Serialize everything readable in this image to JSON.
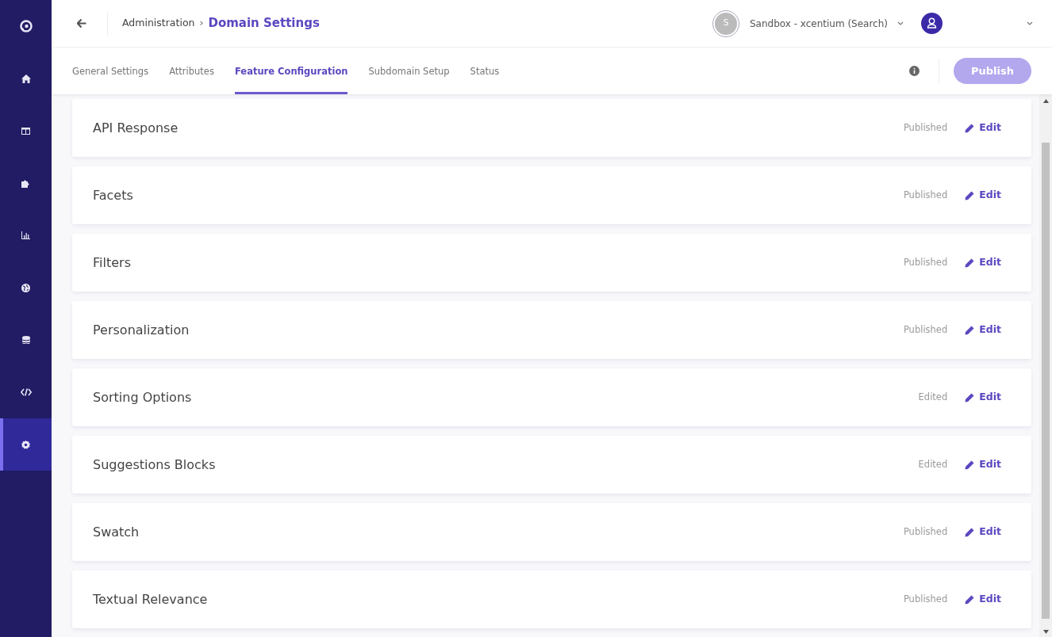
{
  "sidebar": {
    "items": [
      {
        "selected": false
      },
      {
        "selected": false
      },
      {
        "selected": false
      },
      {
        "selected": false
      },
      {
        "selected": false
      },
      {
        "selected": false
      },
      {
        "selected": false
      },
      {
        "selected": false
      },
      {
        "selected": true
      }
    ]
  },
  "header": {
    "breadcrumb": "Administration",
    "separator": "›",
    "title": "Domain Settings",
    "workspace": {
      "avatar": "S",
      "label": "Sandbox - xcentium (Search)"
    }
  },
  "tabs": [
    {
      "label": "General Settings",
      "selected": false
    },
    {
      "label": "Attributes",
      "selected": false
    },
    {
      "label": "Feature Configuration",
      "selected": true
    },
    {
      "label": "Subdomain Setup",
      "selected": false
    },
    {
      "label": "Status",
      "selected": false
    }
  ],
  "publish_button": {
    "label": "Publish",
    "disabled": true
  },
  "features": [
    {
      "name": "API Response",
      "status": "Published",
      "action": "Edit"
    },
    {
      "name": "Facets",
      "status": "Published",
      "action": "Edit"
    },
    {
      "name": "Filters",
      "status": "Published",
      "action": "Edit"
    },
    {
      "name": "Personalization",
      "status": "Published",
      "action": "Edit"
    },
    {
      "name": "Sorting Options",
      "status": "Edited",
      "action": "Edit"
    },
    {
      "name": "Suggestions Blocks",
      "status": "Edited",
      "action": "Edit"
    },
    {
      "name": "Swatch",
      "status": "Published",
      "action": "Edit"
    },
    {
      "name": "Textual Relevance",
      "status": "Published",
      "action": "Edit"
    }
  ]
}
